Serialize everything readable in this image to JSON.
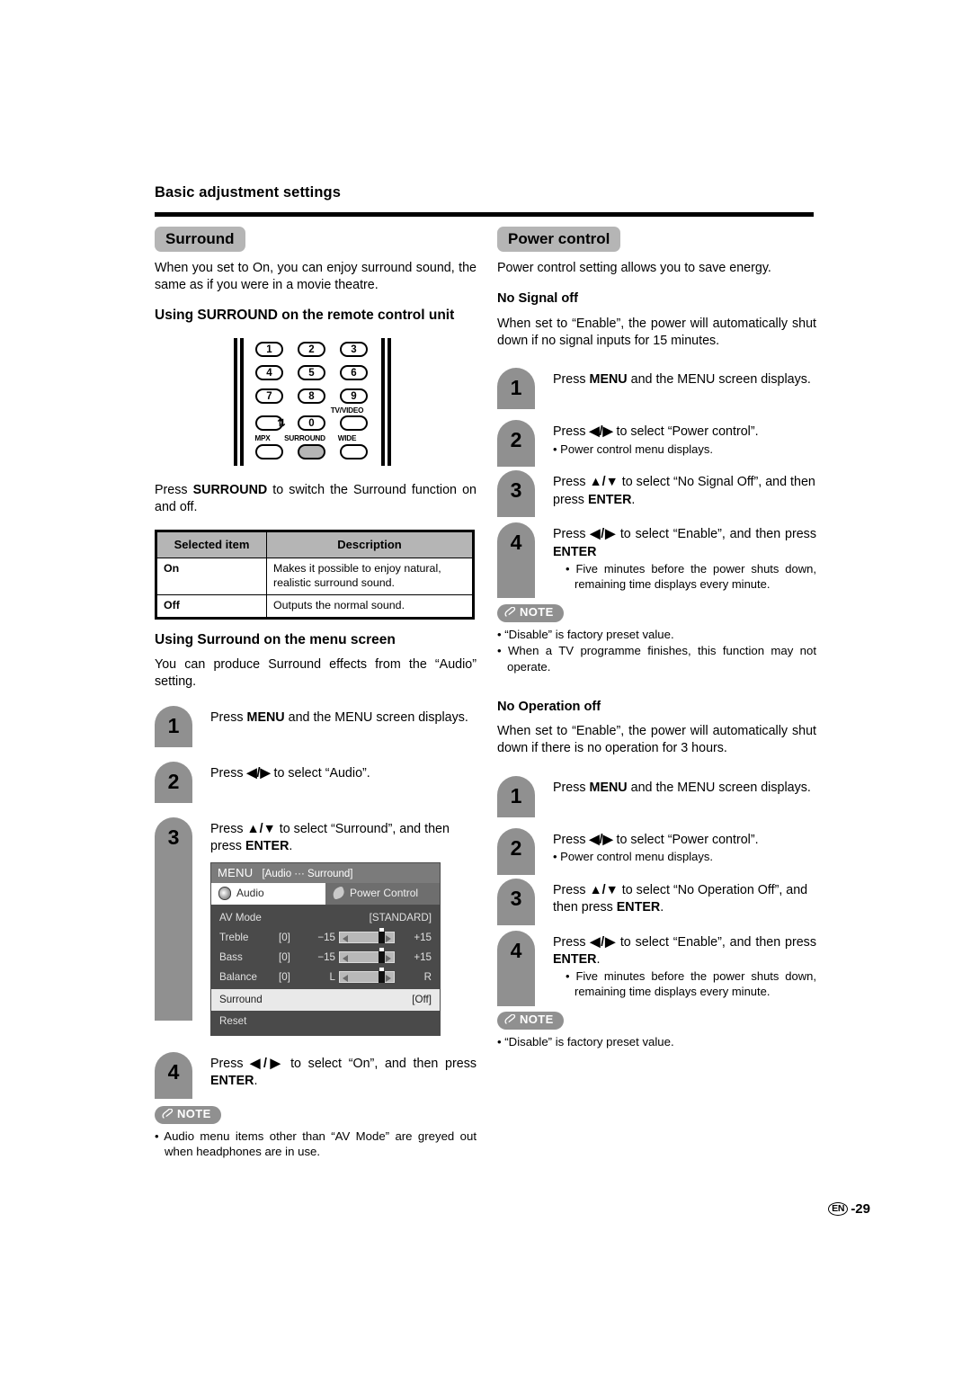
{
  "page": {
    "section_title": "Basic adjustment settings",
    "footer_lang": "EN",
    "footer_page": "-29",
    "accent_gray": "#909090",
    "pill_gray": "#b5b5b5"
  },
  "left": {
    "heading": "Surround",
    "intro": "When you set to On, you can enjoy surround sound, the same as if you were in a movie theatre.",
    "sub_heading": "Using SURROUND on the remote control unit",
    "remote": {
      "keys": [
        "1",
        "2",
        "3",
        "4",
        "5",
        "6",
        "7",
        "8",
        "9",
        "0"
      ],
      "labels": [
        "MPX",
        "SURROUND",
        "WIDE",
        "TV/VIDEO"
      ],
      "repeat_icon": "repeat-icon"
    },
    "press_text_pre": "Press ",
    "press_text_bold": "SURROUND",
    "press_text_post": " to switch the Surround function on and off.",
    "table": {
      "headers": [
        "Selected item",
        "Description"
      ],
      "rows": [
        [
          "On",
          "Makes it possible to enjoy natural, realistic surround sound."
        ],
        [
          "Off",
          "Outputs the normal sound."
        ]
      ]
    },
    "menu_heading": "Using Surround on the menu screen",
    "menu_intro": "You can produce Surround effects from the “Audio” setting.",
    "steps": [
      {
        "num": "1",
        "text": "Press MENU and the MENU screen displays."
      },
      {
        "num": "2",
        "text": "Press ◀/▶ to select “Audio”."
      },
      {
        "num": "3",
        "text": "Press ▲/▼ to select “Surround”, and then press ENTER."
      },
      {
        "num": "4",
        "text": "Press ◀/▶ to select “On”, and then press ENTER."
      }
    ],
    "note_label": "NOTE",
    "notes": [
      "Audio menu items other than “AV Mode” are greyed out when headphones are in use."
    ]
  },
  "tvmenu": {
    "title": "MENU",
    "path": "[Audio ··· Surround]",
    "tabs": [
      {
        "label": "Audio",
        "icon": "speaker-icon",
        "active": true
      },
      {
        "label": "Power Control",
        "icon": "leaf-icon",
        "active": false
      }
    ],
    "rows": [
      {
        "name": "AV Mode",
        "value": "[STANDARD]"
      },
      {
        "name": "Treble",
        "bracket": "[0]",
        "min": "−15",
        "max": "+15"
      },
      {
        "name": "Bass",
        "bracket": "[0]",
        "min": "−15",
        "max": "+15"
      },
      {
        "name": "Balance",
        "bracket": "[0]",
        "min": "L",
        "max": "R"
      },
      {
        "name": "Surround",
        "value": "[Off]",
        "highlighted": true
      },
      {
        "name": "Reset",
        "value": ""
      }
    ]
  },
  "right": {
    "heading": "Power control",
    "intro": "Power control setting allows you to save energy.",
    "no_signal": {
      "heading": "No Signal off",
      "body": "When set to “Enable”, the power will automatically shut down if no signal inputs for 15 minutes.",
      "steps": [
        {
          "num": "1",
          "text": "Press MENU and the MENU screen displays."
        },
        {
          "num": "2",
          "text": "Press ◀/▶ to select “Power control”.",
          "bullet": "Power control menu displays."
        },
        {
          "num": "3",
          "text": "Press ▲/▼ to select “No Signal Off”, and then press ENTER."
        },
        {
          "num": "4",
          "text": "Press ◀/▶ to select “Enable”, and then press ENTER",
          "bullet": "Five minutes before the power shuts down, remaining time displays every minute."
        }
      ],
      "note_label": "NOTE",
      "notes": [
        "“Disable” is factory preset value.",
        "When a TV programme finishes, this function may not operate."
      ]
    },
    "no_operation": {
      "heading": "No Operation off",
      "body": "When set to “Enable”, the power will automatically shut down if there is no operation for 3 hours.",
      "steps": [
        {
          "num": "1",
          "text": "Press MENU and the MENU screen displays."
        },
        {
          "num": "2",
          "text": "Press ◀/▶ to select “Power control”.",
          "bullet": "Power control menu displays."
        },
        {
          "num": "3",
          "text": "Press ▲/▼ to select “No Operation Off”, and then press ENTER."
        },
        {
          "num": "4",
          "text": "Press ◀/▶ to select “Enable”, and then press ENTER.",
          "bullet": "Five minutes before the power shuts down, remaining time displays every minute."
        }
      ],
      "note_label": "NOTE",
      "notes": [
        "“Disable” is factory preset value."
      ]
    }
  }
}
